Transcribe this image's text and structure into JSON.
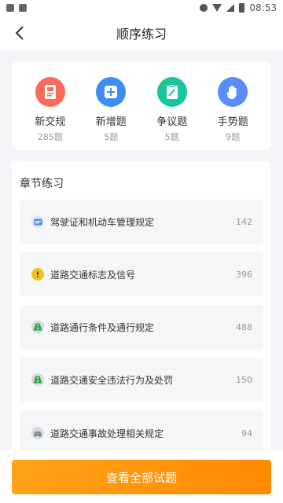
{
  "status_bar": {
    "time": "08:53"
  },
  "nav": {
    "title": "顺序练习"
  },
  "categories": [
    {
      "label": "新交规",
      "count": "285题",
      "icon": "newspaper-icon",
      "color": "#fb6a5b"
    },
    {
      "label": "新增题",
      "count": "5题",
      "icon": "plus-square-icon",
      "color": "#3d8df5"
    },
    {
      "label": "争议题",
      "count": "5题",
      "icon": "clipboard-pen-icon",
      "color": "#19c59a"
    },
    {
      "label": "手势题",
      "count": "9题",
      "icon": "hand-icon",
      "color": "#5a8df6"
    }
  ],
  "chapters": {
    "title": "章节练习",
    "items": [
      {
        "label": "驾驶证和机动车管理规定",
        "count": "142",
        "icon": "license-card-icon"
      },
      {
        "label": "道路交通标志及信号",
        "count": "396",
        "icon": "warning-sign-icon"
      },
      {
        "label": "道路通行条件及通行规定",
        "count": "488",
        "icon": "road-icon"
      },
      {
        "label": "道路交通安全违法行为及处罚",
        "count": "150",
        "icon": "road-icon"
      },
      {
        "label": "道路交通事故处理相关规定",
        "count": "94",
        "icon": "car-accident-icon"
      }
    ]
  },
  "bottom": {
    "button_label": "查看全部试题"
  }
}
